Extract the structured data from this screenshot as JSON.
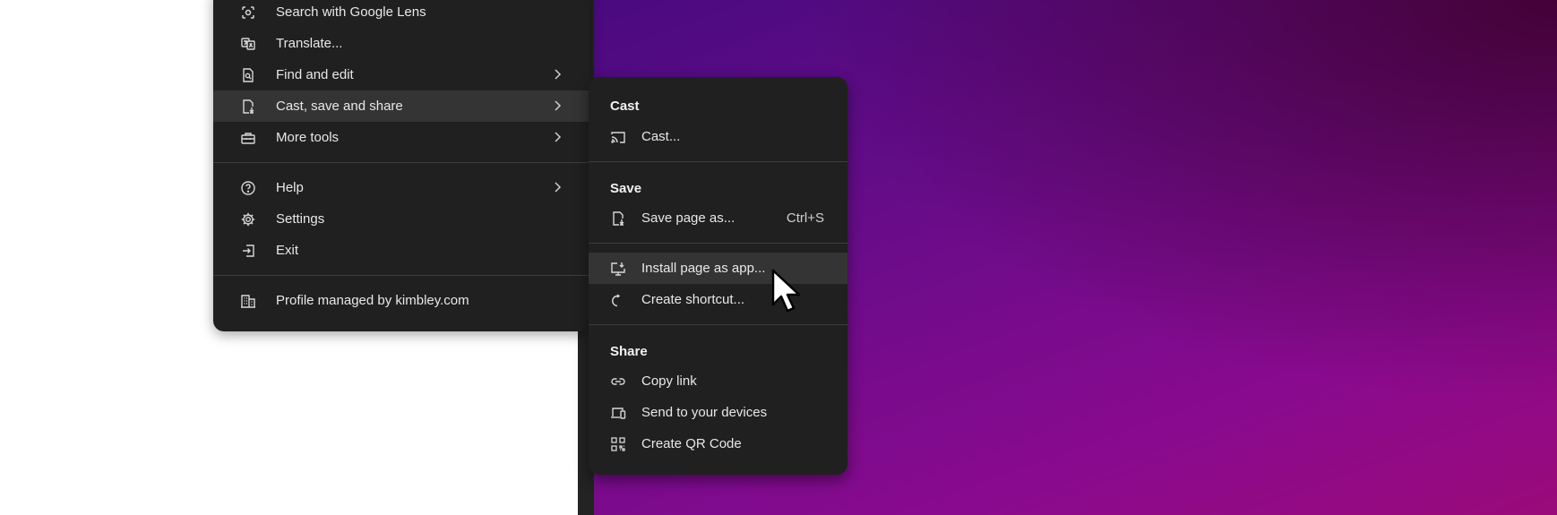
{
  "main_menu": {
    "items": [
      {
        "label": "Search with Google Lens",
        "icon": "google-lens-icon",
        "submenu": false
      },
      {
        "label": "Translate...",
        "icon": "translate-icon",
        "submenu": false
      },
      {
        "label": "Find and edit",
        "icon": "find-in-page-icon",
        "submenu": true
      },
      {
        "label": "Cast, save and share",
        "icon": "file-download-icon",
        "submenu": true,
        "highlighted": true
      },
      {
        "label": "More tools",
        "icon": "toolbox-icon",
        "submenu": true
      },
      {
        "label": "Help",
        "icon": "help-circle-icon",
        "submenu": true
      },
      {
        "label": "Settings",
        "icon": "gear-icon",
        "submenu": false
      },
      {
        "label": "Exit",
        "icon": "exit-icon",
        "submenu": false
      }
    ],
    "profile_managed": "Profile managed by kimbley.com"
  },
  "sub_menu": {
    "cast": {
      "header": "Cast",
      "cast_item": "Cast..."
    },
    "save": {
      "header": "Save",
      "save_page": "Save page as...",
      "save_shortcut": "Ctrl+S",
      "install_app": "Install page as app...",
      "create_shortcut": "Create shortcut..."
    },
    "share": {
      "header": "Share",
      "copy_link": "Copy link",
      "send_devices": "Send to your devices",
      "qr_code": "Create QR Code"
    }
  },
  "colors": {
    "menu_bg": "#202020",
    "highlight_bg": "#343434",
    "wallpaper_purple": "#6a0c8a",
    "wallpaper_magenta": "#9a0a7a"
  }
}
